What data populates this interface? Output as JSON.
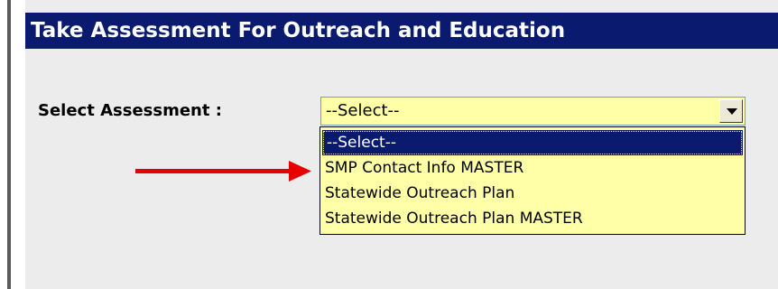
{
  "title": "Take Assessment For Outreach and Education",
  "select_label": "Select Assessment :",
  "select_value": "--Select--",
  "options": [
    "--Select--",
    "SMP Contact Info MASTER",
    "Statewide Outreach Plan",
    "Statewide Outreach Plan MASTER"
  ],
  "colors": {
    "title_bar": "#0a1a6e",
    "select_background": "#ffffa8",
    "panel_background": "#ececec",
    "annotation_arrow": "#e60000"
  },
  "icons": {
    "dropdown_toggle": "chevron-down-icon",
    "annotation": "red-arrow-icon"
  }
}
